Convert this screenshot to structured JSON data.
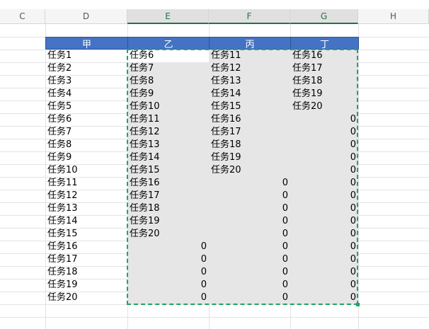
{
  "column_headers": [
    "C",
    "D",
    "E",
    "F",
    "G",
    "H"
  ],
  "table_headers": [
    "甲",
    "乙",
    "丙",
    "丁"
  ],
  "col_d": [
    "任务1",
    "任务2",
    "任务3",
    "任务4",
    "任务5",
    "任务6",
    "任务7",
    "任务8",
    "任务9",
    "任务10",
    "任务11",
    "任务12",
    "任务13",
    "任务14",
    "任务15",
    "任务16",
    "任务17",
    "任务18",
    "任务19",
    "任务20"
  ],
  "col_e": [
    "任务6",
    "任务7",
    "任务8",
    "任务9",
    "任务10",
    "任务11",
    "任务12",
    "任务13",
    "任务14",
    "任务15",
    "任务16",
    "任务17",
    "任务18",
    "任务19",
    "任务20",
    "0",
    "0",
    "0",
    "0",
    "0"
  ],
  "col_f": [
    "任务11",
    "任务12",
    "任务13",
    "任务14",
    "任务15",
    "任务16",
    "任务17",
    "任务18",
    "任务19",
    "任务20",
    "0",
    "0",
    "0",
    "0",
    "0",
    "0",
    "0",
    "0",
    "0",
    "0"
  ],
  "col_g": [
    "任务16",
    "任务17",
    "任务18",
    "任务19",
    "任务20",
    "0",
    "0",
    "0",
    "0",
    "0",
    "0",
    "0",
    "0",
    "0",
    "0",
    "0",
    "0",
    "0",
    "0",
    "0"
  ],
  "colors": {
    "header_fill": "#4472c4",
    "selection": "#21a366",
    "selected_fill": "#e6e6e6"
  }
}
